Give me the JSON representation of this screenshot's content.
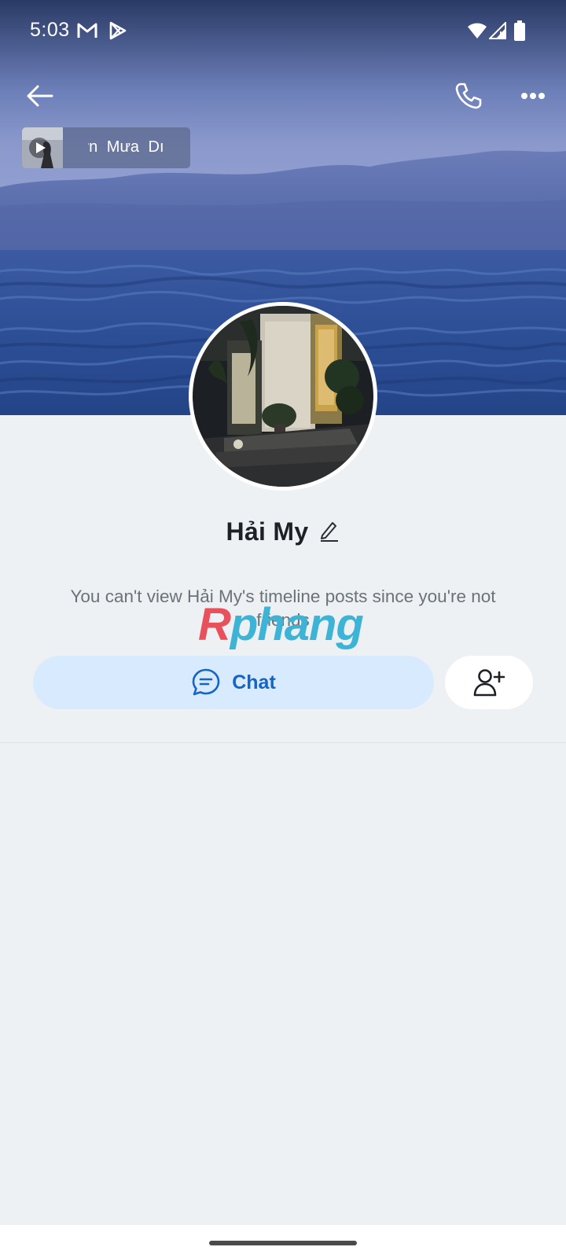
{
  "status_bar": {
    "time": "5:03",
    "left_icons": [
      "gmail-icon",
      "play-store-icon"
    ],
    "right_icons": [
      "wifi-icon",
      "cellular-signal-icon",
      "battery-icon"
    ]
  },
  "top_bar": {
    "back_icon": "arrow-left-icon",
    "call_icon": "phone-icon",
    "more_icon": "more-horizontal-icon"
  },
  "music": {
    "title": "ơn Mưa      Dı"
  },
  "profile": {
    "name": "Hải My",
    "notice": "You can't view Hải My's timeline posts since you're not friends"
  },
  "actions": {
    "chat_label": "Chat",
    "chat_icon": "chat-bubble-icon",
    "add_friend_icon": "user-plus-icon"
  },
  "watermark": {
    "first": "R",
    "rest": "phang"
  },
  "colors": {
    "background": "#eef1f3",
    "chat_button_bg": "#d8eafd",
    "chat_accent": "#1565c8",
    "name_text": "#1d2126",
    "notice_text": "#6b7278"
  }
}
